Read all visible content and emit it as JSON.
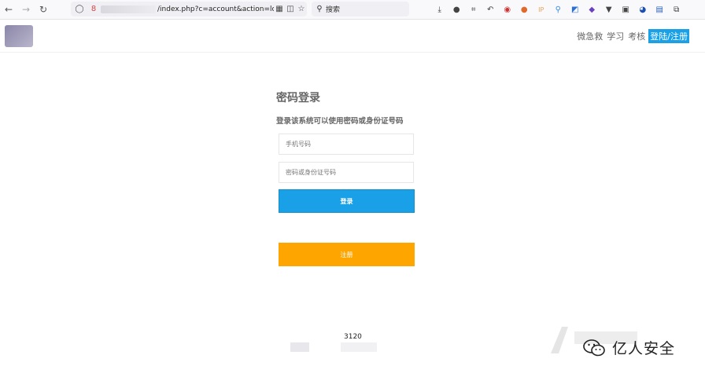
{
  "browser": {
    "url": "/index.php?c=account&action=log",
    "search_placeholder": "搜索"
  },
  "header": {
    "nav": [
      "微急救",
      "学习",
      "考核"
    ],
    "login_link": "登陆/注册"
  },
  "form": {
    "title": "密码登录",
    "subtitle": "登录该系统可以使用密码或身份证号码",
    "phone_placeholder": "手机号码",
    "password_placeholder": "密码或身份证号码",
    "login_button": "登录",
    "register_button": "注册"
  },
  "footer": {
    "text": "3120"
  },
  "watermark": {
    "brand": "亿人安全"
  }
}
